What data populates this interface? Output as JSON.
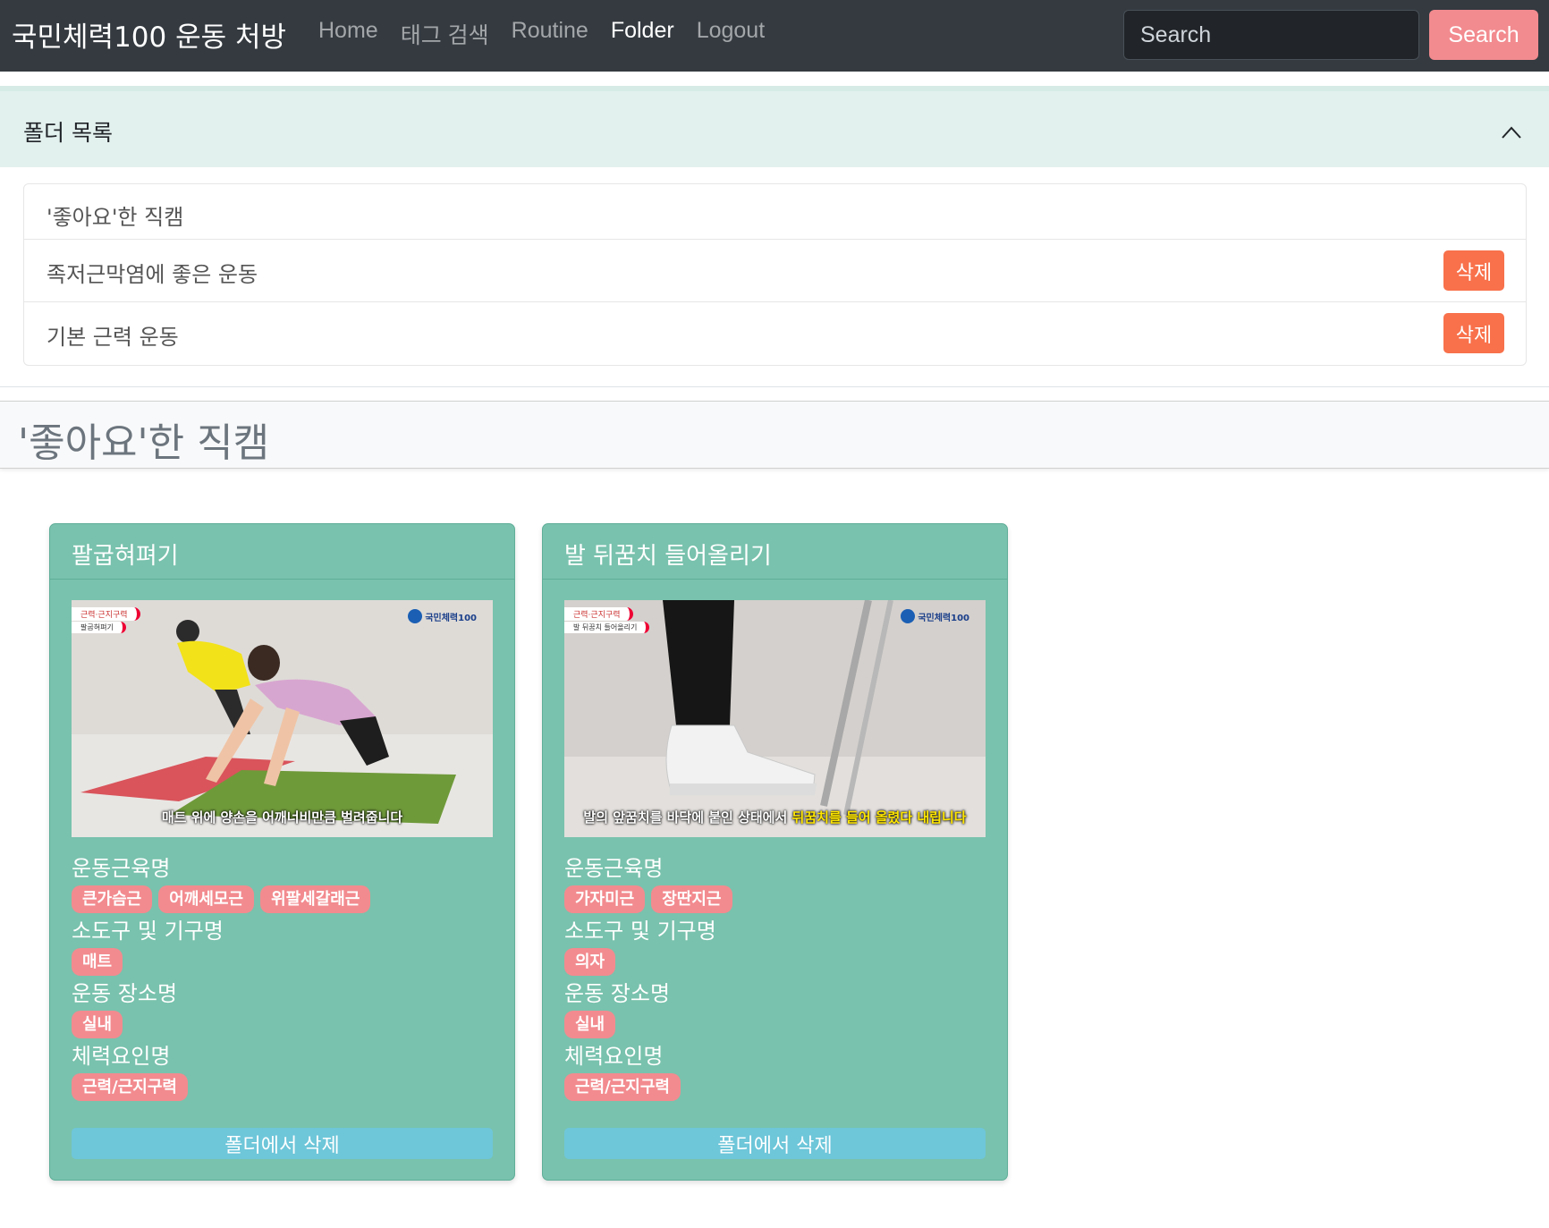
{
  "navbar": {
    "brand": "국민체력100 운동 처방",
    "links": [
      {
        "label": "Home",
        "active": false
      },
      {
        "label": "태그 검색",
        "active": false
      },
      {
        "label": "Routine",
        "active": false
      },
      {
        "label": "Folder",
        "active": true
      },
      {
        "label": "Logout",
        "active": false
      }
    ],
    "search_placeholder": "Search",
    "search_button": "Search"
  },
  "folder_list": {
    "title": "폴더 목록",
    "items": [
      {
        "label": "'좋아요'한 직캠",
        "delete_label": ""
      },
      {
        "label": "족저근막염에 좋은 운동",
        "delete_label": "삭제"
      },
      {
        "label": "기본 근력 운동",
        "delete_label": "삭제"
      }
    ]
  },
  "current_folder": {
    "title": "'좋아요'한 직캠"
  },
  "labels": {
    "muscles": "운동근육명",
    "tools": "소도구 및 기구명",
    "location": "운동 장소명",
    "fitness": "체력요인명",
    "remove": "폴더에서 삭제"
  },
  "cards": [
    {
      "title": "팔굽혀펴기",
      "thumb_tag": "근력·근지구력",
      "thumb_subtag": "팔굽혀펴기",
      "thumb_logo": "국민체력100",
      "thumb_caption": "매트 위에 양손을 어깨너비만큼 벌려줍니다",
      "thumb_caption_hl": "",
      "muscles": [
        "큰가슴근",
        "어깨세모근",
        "위팔세갈래근"
      ],
      "tools": [
        "매트"
      ],
      "location": [
        "실내"
      ],
      "fitness": [
        "근력/근지구력"
      ]
    },
    {
      "title": "발 뒤꿈치 들어올리기",
      "thumb_tag": "근력·근지구력",
      "thumb_subtag": "발 뒤꿈치 들어올리기",
      "thumb_logo": "국민체력100",
      "thumb_caption": "발의 앞꿈치를 바닥에 붙인 상태에서 ",
      "thumb_caption_hl": "뒤꿈치를 들어 올렸다 내립니다",
      "muscles": [
        "가자미근",
        "장딴지근"
      ],
      "tools": [
        "의자"
      ],
      "location": [
        "실내"
      ],
      "fitness": [
        "근력/근지구력"
      ]
    }
  ],
  "colors": {
    "navbar_bg": "#343a40",
    "search_button": "#f28b8f",
    "accordion_header": "#e3f1ee",
    "delete_button": "#f8714b",
    "card_bg": "#79c2ad",
    "badge": "#f28b8f",
    "remove_button": "#6ec6d9"
  }
}
